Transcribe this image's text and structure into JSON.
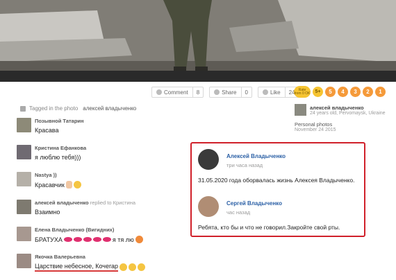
{
  "actions": {
    "comment": {
      "label": "Comment",
      "count": "8"
    },
    "share": {
      "label": "Share",
      "count": "0"
    },
    "like": {
      "label": "Like",
      "count": "24"
    }
  },
  "rating": {
    "rate_label_1": "Rate",
    "rate_label_2": "from 0 OK",
    "plus": "5+",
    "stars": [
      "5",
      "4",
      "3",
      "2",
      "1"
    ]
  },
  "tagged": {
    "label": "Tagged in the photo",
    "person": "алексей владыченко"
  },
  "comments": [
    {
      "name": "Позывной Татарин",
      "text": "Красава"
    },
    {
      "name": "Кристина Ефанкова",
      "text": "я люблю тебя)))"
    },
    {
      "name": "Nastya ))",
      "text": "Красавчик"
    },
    {
      "name": "алексей владыченко",
      "reply": "replied to Кристина",
      "text": "Взаимно"
    },
    {
      "name": "Елена Владыченко (Вигидних)",
      "text": "БРАТУХА",
      "tail": "я тя лю"
    },
    {
      "name": "Якочка Валерьевна",
      "text": "Царствие небесное, Кочегар"
    }
  ],
  "owner": {
    "name": "алексей владыченко",
    "sub": "24 years old, Pervomaysk, Ukraine",
    "album": "Personal photos",
    "date": "November 24 2015"
  },
  "highlight": {
    "posts": [
      {
        "name": "Алексей Владыченко",
        "time": "три часа назад",
        "text": "31.05.2020 года оборвалась жизнь Алексея Владыченко."
      },
      {
        "name": "Сергей Владыченко",
        "time": "час назад",
        "text": "Ребята, кто бы и что не говорил.Закройте свой рты."
      }
    ]
  },
  "colors": {
    "highlight_border": "#d0202a",
    "name_link": "#2a5fa5",
    "rating_star": "#f59a3a",
    "rating_pill": "#f6c431"
  }
}
